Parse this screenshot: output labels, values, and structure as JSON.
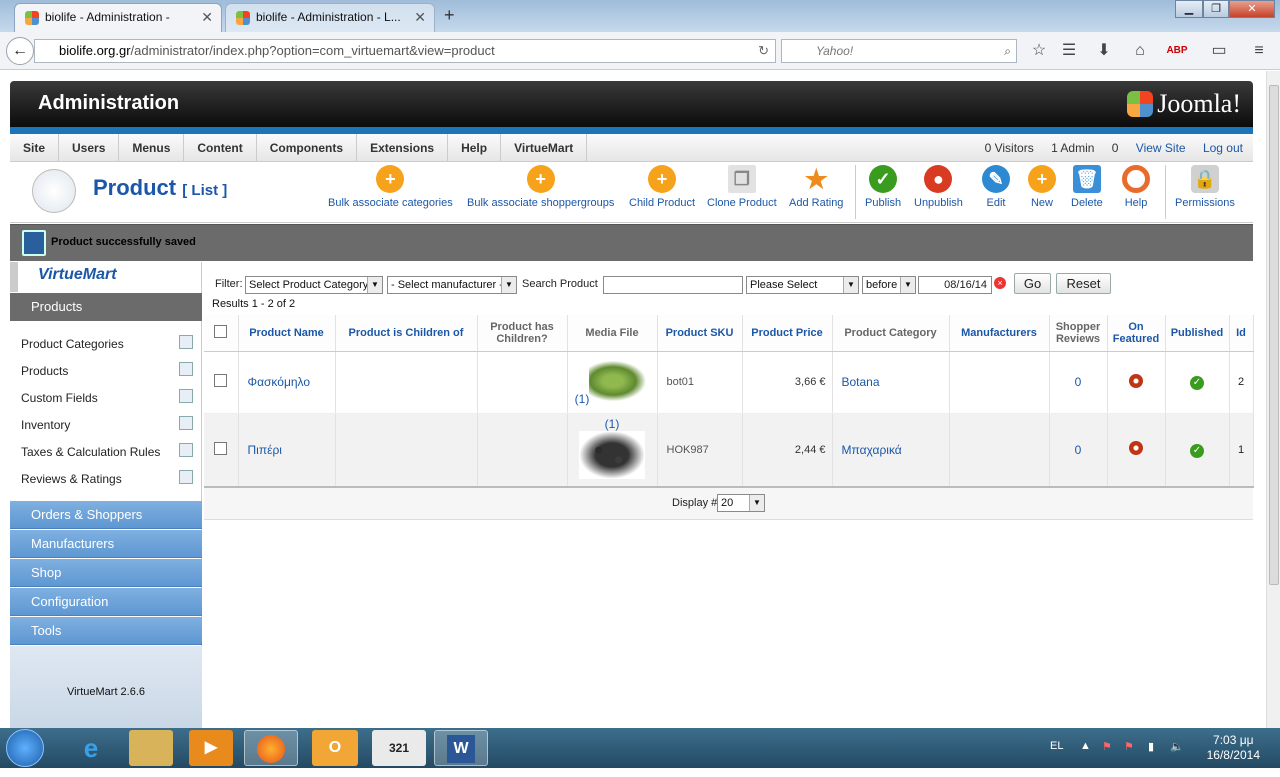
{
  "browser": {
    "tabs": [
      {
        "title": "biolife - Administration -"
      },
      {
        "title": "biolife - Administration - L..."
      }
    ],
    "url_host": "biolife.org.gr",
    "url_path": "/administrator/index.php?option=com_virtuemart&view=product",
    "search_placeholder": "Yahoo!"
  },
  "header": {
    "title": "Administration",
    "logo_text": "Joomla!"
  },
  "menu": [
    "Site",
    "Users",
    "Menus",
    "Content",
    "Components",
    "Extensions",
    "Help",
    "VirtueMart"
  ],
  "status": {
    "visitors": "0 Visitors",
    "admins": "1 Admin",
    "messages": "0",
    "view_site": "View Site",
    "logout": "Log out"
  },
  "toolbar": {
    "title": "Product",
    "subtitle": "[ List ]",
    "buttons": [
      {
        "label": "Bulk associate categories",
        "icon": "plus-icon",
        "color": "#f7a21b"
      },
      {
        "label": "Bulk associate shoppergroups",
        "icon": "plus-icon",
        "color": "#f7a21b"
      },
      {
        "label": "Child Product",
        "icon": "plus-icon",
        "color": "#f7a21b"
      },
      {
        "label": "Clone Product",
        "icon": "copy-icon",
        "color": "#d9d9d9"
      },
      {
        "label": "Add Rating",
        "icon": "star-icon",
        "color": "#ef8a1c"
      },
      {
        "label": "Publish",
        "icon": "check-icon",
        "color": "#3a9c1e"
      },
      {
        "label": "Unpublish",
        "icon": "stop-icon",
        "color": "#d93b22"
      },
      {
        "label": "Edit",
        "icon": "pencil-icon",
        "color": "#2d8ad2"
      },
      {
        "label": "New",
        "icon": "plus-icon",
        "color": "#f7a21b"
      },
      {
        "label": "Delete",
        "icon": "trash-icon",
        "color": "#3b8fd6"
      },
      {
        "label": "Help",
        "icon": "lifebuoy-icon",
        "color": "#e96b2c"
      },
      {
        "label": "Permissions",
        "icon": "lock-icon",
        "color": "#bfbfbf"
      }
    ]
  },
  "message": "Product successfully saved",
  "sidebar": {
    "section_products": "Products",
    "items": [
      "Product Categories",
      "Products",
      "Custom Fields",
      "Inventory",
      "Taxes & Calculation Rules",
      "Reviews & Ratings"
    ],
    "sections": [
      "Orders & Shoppers",
      "Manufacturers",
      "Shop",
      "Configuration",
      "Tools"
    ],
    "version": "VirtueMart 2.6.6"
  },
  "filter": {
    "label": "Filter:",
    "category": "Select Product Category",
    "manufacturer": "- Select manufacturer -",
    "search_label": "Search Product",
    "search_value": "",
    "please_select": "Please Select",
    "before": "before",
    "date": "08/16/14",
    "go": "Go",
    "reset": "Reset"
  },
  "results": "Results 1 - 2 of 2",
  "columns": [
    "Product Name",
    "Product is Children of",
    "Product has Children?",
    "Media File",
    "Product SKU",
    "Product Price",
    "Product Category",
    "Manufacturers",
    "Shopper Reviews",
    "On Featured",
    "Published",
    "Id"
  ],
  "rows": [
    {
      "name": "Φασκόμηλο",
      "media": "(1)",
      "sku": "bot01",
      "price": "3,66 €",
      "category": "Botana",
      "reviews": "0",
      "id": "2"
    },
    {
      "name": "Πιπέρι",
      "media": "(1)",
      "sku": "HOK987",
      "price": "2,44 €",
      "category": "Μπαχαρικά",
      "reviews": "0",
      "id": "1"
    }
  ],
  "display": {
    "label": "Display #",
    "value": "20"
  },
  "taskbar": {
    "lang": "EL",
    "time": "7:03 μμ",
    "date": "16/8/2014"
  }
}
